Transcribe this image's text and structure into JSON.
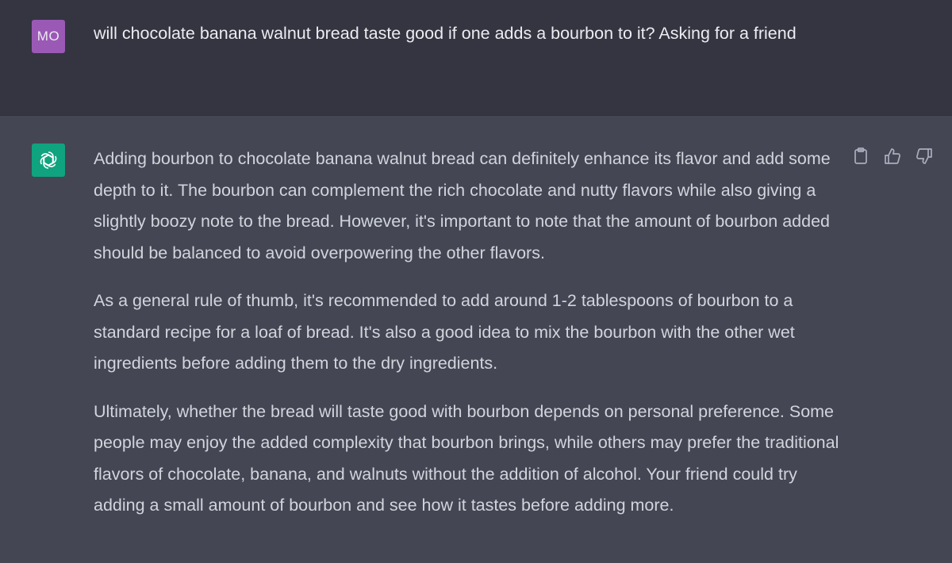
{
  "user_message": {
    "avatar_initials": "MO",
    "text": "will chocolate banana walnut bread taste good if one adds a bourbon to it? Asking for a friend"
  },
  "assistant_message": {
    "avatar_icon": "openai-logo-icon",
    "paragraphs": [
      "Adding bourbon to chocolate banana walnut bread can definitely enhance its flavor and add some depth to it. The bourbon can complement the rich chocolate and nutty flavors while also giving a slightly boozy note to the bread. However, it's important to note that the amount of bourbon added should be balanced to avoid overpowering the other flavors.",
      "As a general rule of thumb, it's recommended to add around 1-2 tablespoons of bourbon to a standard recipe for a loaf of bread. It's also a good idea to mix the bourbon with the other wet ingredients before adding them to the dry ingredients.",
      "Ultimately, whether the bread will taste good with bourbon depends on personal preference. Some people may enjoy the added complexity that bourbon brings, while others may prefer the traditional flavors of chocolate, banana, and walnuts without the addition of alcohol. Your friend could try adding a small amount of bourbon and see how it tastes before adding more."
    ],
    "actions": [
      "clipboard-icon",
      "thumbs-up-icon",
      "thumbs-down-icon"
    ]
  },
  "colors": {
    "user_bg": "#343541",
    "assistant_bg": "#444654",
    "user_avatar": "#9b59b6",
    "bot_avatar": "#10a37f",
    "text": "#d1d5db"
  }
}
